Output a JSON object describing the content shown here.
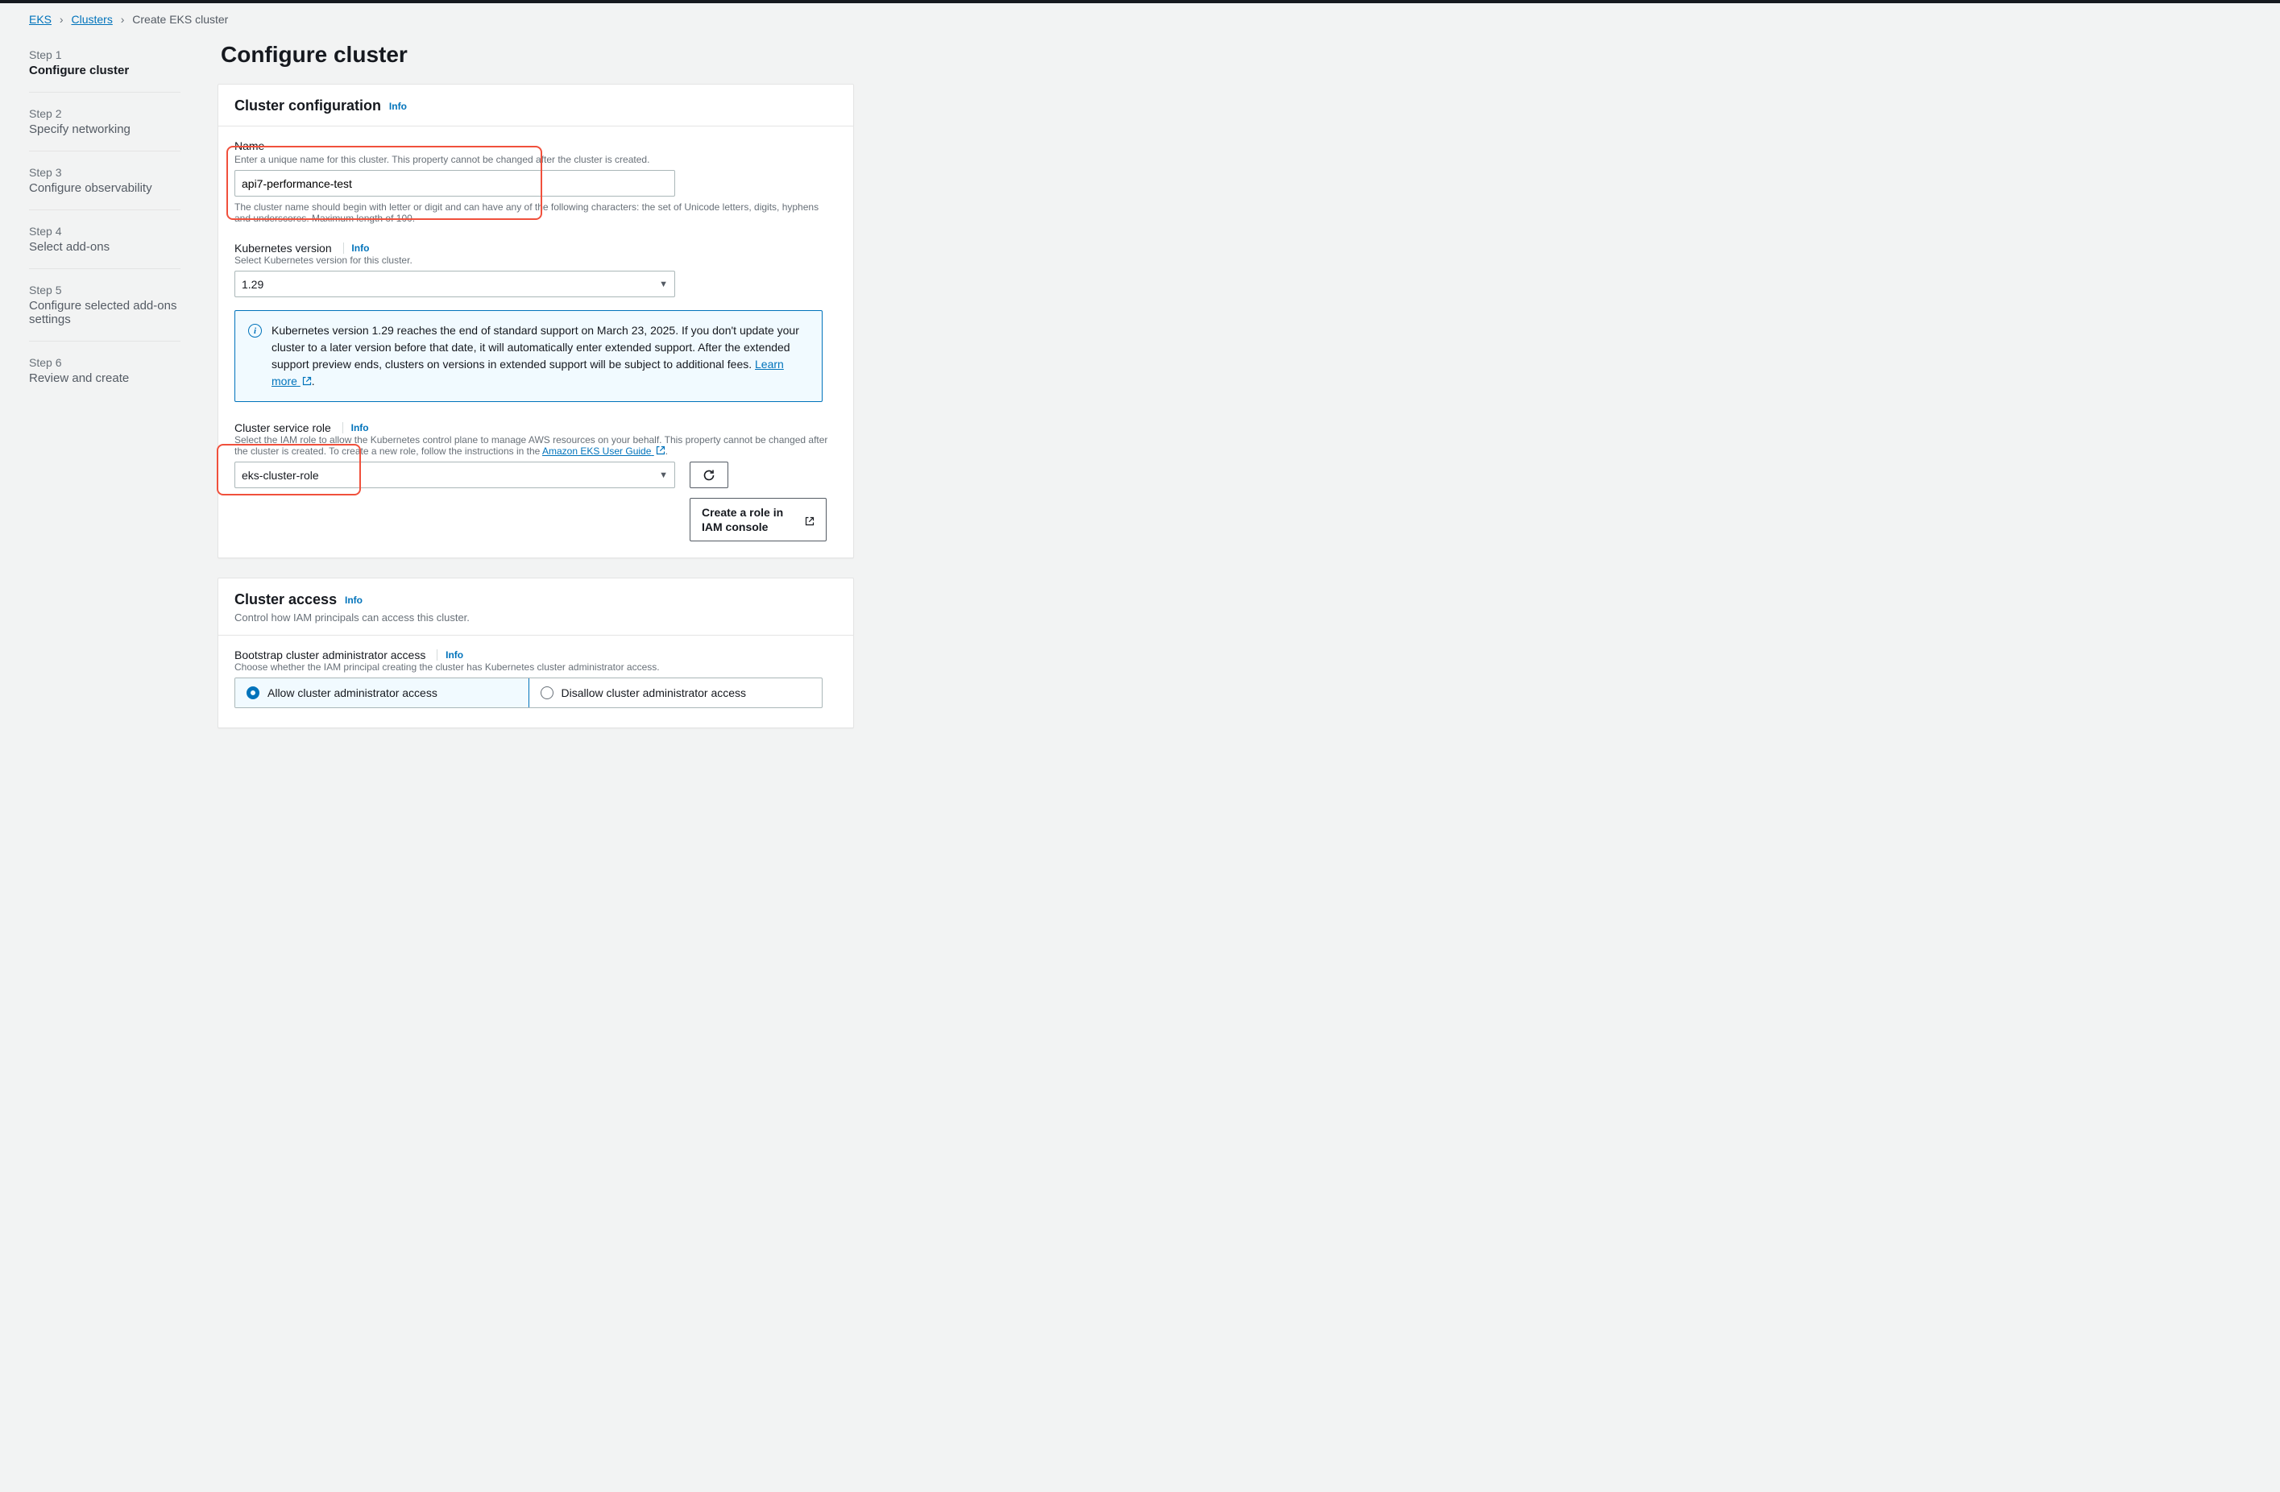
{
  "breadcrumb": {
    "root": "EKS",
    "clusters": "Clusters",
    "current": "Create EKS cluster"
  },
  "steps": [
    {
      "label": "Step 1",
      "title": "Configure cluster"
    },
    {
      "label": "Step 2",
      "title": "Specify networking"
    },
    {
      "label": "Step 3",
      "title": "Configure observability"
    },
    {
      "label": "Step 4",
      "title": "Select add-ons"
    },
    {
      "label": "Step 5",
      "title": "Configure selected add-ons settings"
    },
    {
      "label": "Step 6",
      "title": "Review and create"
    }
  ],
  "page_title": "Configure cluster",
  "info_label": "Info",
  "panels": {
    "config": {
      "heading": "Cluster configuration",
      "name": {
        "label": "Name",
        "help": "Enter a unique name for this cluster. This property cannot be changed after the cluster is created.",
        "value": "api7-performance-test",
        "constraint": "The cluster name should begin with letter or digit and can have any of the following characters: the set of Unicode letters, digits, hyphens and underscores. Maximum length of 100."
      },
      "k8s": {
        "label": "Kubernetes version",
        "help": "Select Kubernetes version for this cluster.",
        "value": "1.29",
        "notice_text": "Kubernetes version 1.29 reaches the end of standard support on March 23, 2025. If you don't update your cluster to a later version before that date, it will automatically enter extended support. After the extended support preview ends, clusters on versions in extended support will be subject to additional fees. ",
        "learn_more": "Learn more"
      },
      "role": {
        "label": "Cluster service role",
        "help_pre": "Select the IAM role to allow the Kubernetes control plane to manage AWS resources on your behalf. This property cannot be changed after the cluster is created. To create a new role, follow the instructions in the ",
        "help_link": "Amazon EKS User Guide",
        "value": "eks-cluster-role",
        "create_btn": "Create a role in IAM console"
      }
    },
    "access": {
      "heading": "Cluster access",
      "subtext": "Control how IAM principals can access this cluster.",
      "bootstrap": {
        "label": "Bootstrap cluster administrator access",
        "help": "Choose whether the IAM principal creating the cluster has Kubernetes cluster administrator access.",
        "allow": "Allow cluster administrator access",
        "disallow": "Disallow cluster administrator access"
      }
    }
  }
}
